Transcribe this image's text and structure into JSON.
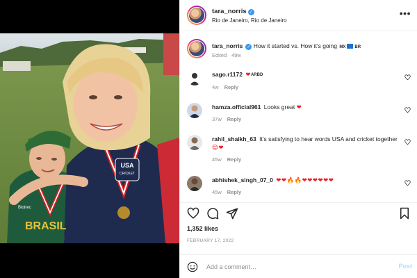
{
  "post": {
    "username": "tara_norris",
    "location": "Rio de Janeiro, Rio de Janeiro",
    "more_label": "•••",
    "verified_mark": "✓"
  },
  "caption": {
    "username": "tara_norris",
    "text": "How it started vs. How it's going",
    "flag_1": "MX",
    "flag_2": "BR",
    "edited": "Edited",
    "age": "49w"
  },
  "comments": [
    {
      "username": "sago.r1172",
      "text": "",
      "tag": "ARBD",
      "age": "4w",
      "reply_label": "Reply",
      "hearts": "❤"
    },
    {
      "username": "hamza.official961",
      "text": "Looks great",
      "age": "37w",
      "reply_label": "Reply",
      "hearts": "❤"
    },
    {
      "username": "rahil_shaikh_63",
      "text": "It's satisfying to hear words USA and cricket together",
      "age": "45w",
      "reply_label": "Reply",
      "hearts": "😊❤"
    },
    {
      "username": "abhishek_singh_07_0",
      "text": "",
      "age": "45w",
      "reply_label": "Reply",
      "hearts": "❤❤🔥🔥❤❤❤❤❤❤"
    }
  ],
  "engagement": {
    "likes": "1,352 likes",
    "date": "FEBRUARY 17, 2022"
  },
  "composer": {
    "placeholder": "Add a comment…",
    "post_label": "Post"
  },
  "photo": {
    "shirt_text_left": "BRASIL",
    "sponsor_text": "Biotrec",
    "badge_text": "USA",
    "badge_subtext": "CRICKET"
  },
  "colors": {
    "verified": "#3897f0",
    "heart": "#ed1c24",
    "post_button": "#b2dffc",
    "meta": "#8e8e8e"
  },
  "icons": {
    "like": "heart-outline-icon",
    "comment": "speech-bubble-icon",
    "share": "paper-plane-icon",
    "save": "bookmark-icon",
    "emoji": "smiley-icon",
    "more": "ellipsis-icon"
  }
}
